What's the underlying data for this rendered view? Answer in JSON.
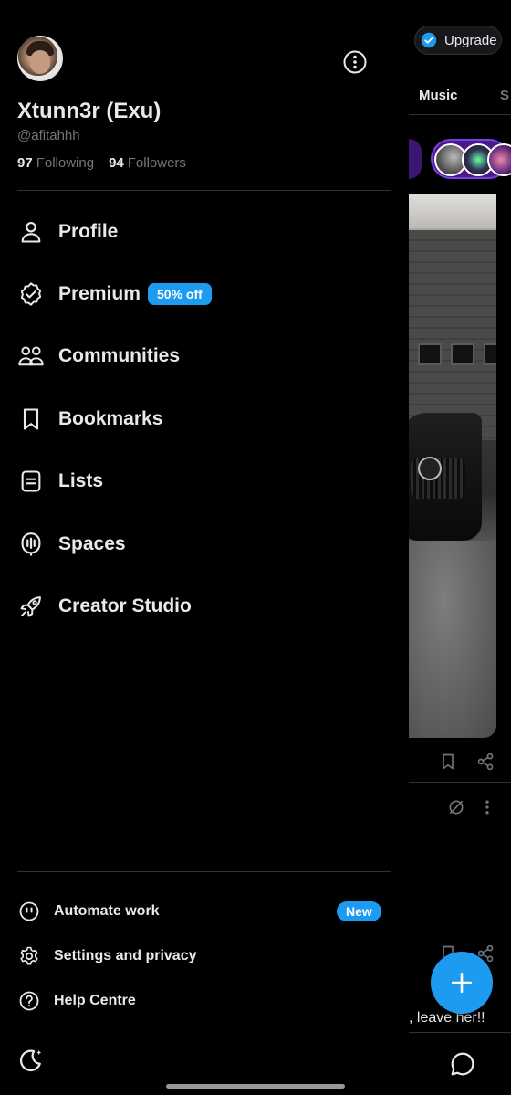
{
  "background": {
    "upgrade_label": "Upgrade",
    "tabs": [
      "Music",
      "S"
    ],
    "post_text": ", leave her!!"
  },
  "profile": {
    "display_name": "Xtunn3r (Exu)",
    "handle": "@afitahhh",
    "following_count": "97",
    "following_label": "Following",
    "followers_count": "94",
    "followers_label": "Followers"
  },
  "nav": [
    {
      "label": "Profile",
      "icon": "person-icon"
    },
    {
      "label": "Premium",
      "icon": "verified-badge-icon",
      "badge": "50% off"
    },
    {
      "label": "Communities",
      "icon": "people-icon"
    },
    {
      "label": "Bookmarks",
      "icon": "bookmark-icon"
    },
    {
      "label": "Lists",
      "icon": "list-icon"
    },
    {
      "label": "Spaces",
      "icon": "microphone-icon"
    },
    {
      "label": "Creator Studio",
      "icon": "rocket-icon"
    }
  ],
  "secondary": [
    {
      "label": "Automate work",
      "icon": "grok-icon",
      "badge": "New"
    },
    {
      "label": "Settings and privacy",
      "icon": "gear-icon"
    },
    {
      "label": "Help Centre",
      "icon": "question-icon"
    }
  ],
  "colors": {
    "accent": "#1d9bf0",
    "background": "#000000",
    "text_primary": "#e7e9ea",
    "text_secondary": "#71767b",
    "divider": "#2f3336"
  }
}
